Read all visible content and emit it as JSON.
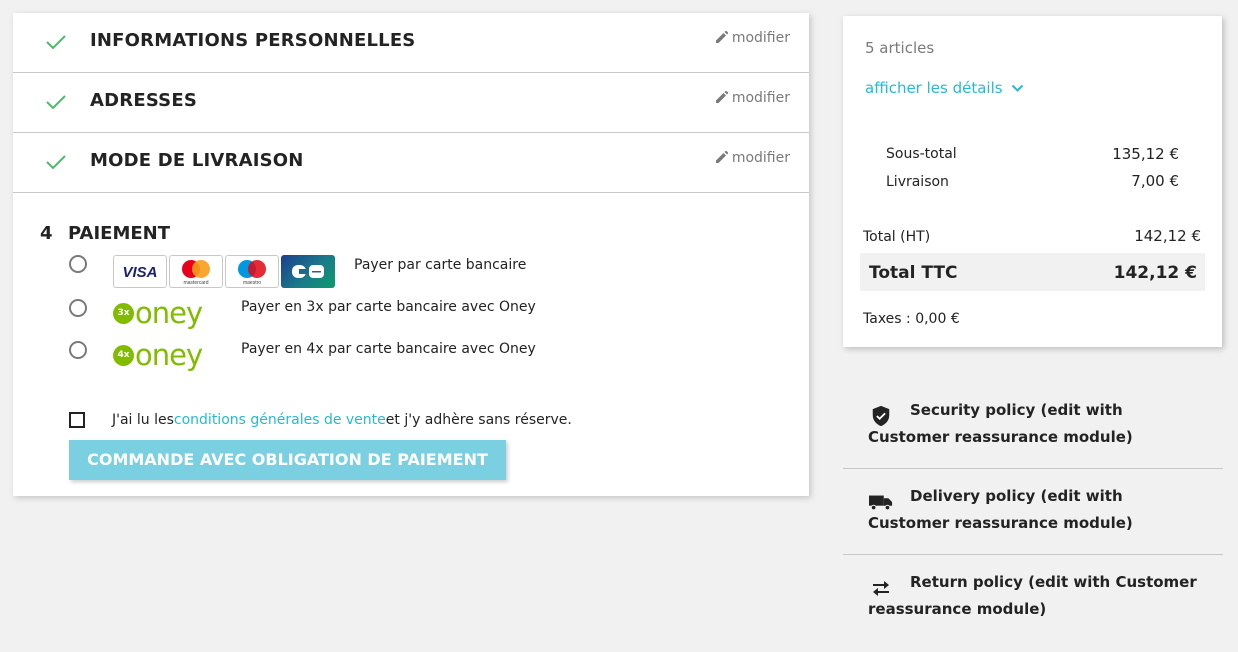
{
  "steps": [
    {
      "title": "INFORMATIONS PERSONNELLES",
      "edit": "modifier"
    },
    {
      "title": "ADRESSES",
      "edit": "modifier"
    },
    {
      "title": "MODE DE LIVRAISON",
      "edit": "modifier"
    }
  ],
  "payment": {
    "number": "4",
    "title": "PAIEMENT",
    "options": [
      {
        "label": "Payer par carte bancaire",
        "logos": [
          "VISA",
          "mastercard",
          "maestro",
          "CB"
        ]
      },
      {
        "label": "Payer en 3x par carte bancaire avec Oney",
        "badge": "3x",
        "brand": "oney"
      },
      {
        "label": "Payer en 4x par carte bancaire avec Oney",
        "badge": "4x",
        "brand": "oney"
      }
    ],
    "terms_before": "J'ai lu les ",
    "terms_link": "conditions générales de vente",
    "terms_after": " et j'y adhère sans réserve.",
    "cta": "COMMANDE AVEC OBLIGATION DE PAIEMENT"
  },
  "summary": {
    "count": "5 articles",
    "details": "afficher les détails",
    "subtotal_label": "Sous-total",
    "subtotal_value": "135,12 €",
    "shipping_label": "Livraison",
    "shipping_value": "7,00 €",
    "total_ht_label": "Total (HT)",
    "total_ht_value": "142,12 €",
    "total_ttc_label": "Total TTC",
    "total_ttc_value": "142,12 €",
    "taxes": "Taxes : 0,00 €"
  },
  "reassurance": [
    {
      "icon": "shield-icon",
      "text": "Security policy (edit with Customer reassurance module)"
    },
    {
      "icon": "truck-icon",
      "text": "Delivery policy (edit with Customer reassurance module)"
    },
    {
      "icon": "swap-arrows-icon",
      "text": "Return policy (edit with Customer reassurance module)"
    }
  ],
  "colors": {
    "accent": "#24b9d7",
    "check": "#4cbb6c",
    "oney": "#81bc00",
    "cta": "#7ad0e1"
  }
}
